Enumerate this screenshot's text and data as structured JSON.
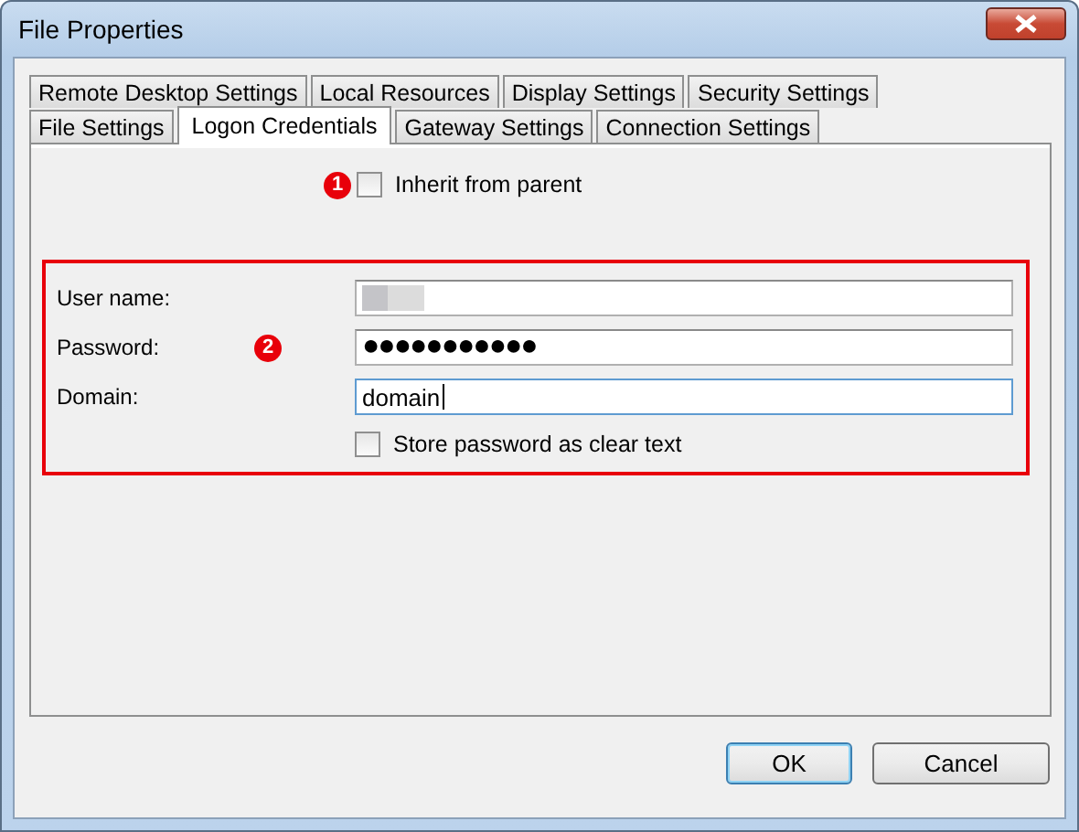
{
  "window": {
    "title": "File Properties"
  },
  "tab_rows": [
    [
      {
        "label": "Remote Desktop Settings",
        "selected": false
      },
      {
        "label": "Local Resources",
        "selected": false
      },
      {
        "label": "Display Settings",
        "selected": false
      },
      {
        "label": "Security Settings",
        "selected": false
      }
    ],
    [
      {
        "label": "File Settings",
        "selected": false
      },
      {
        "label": "Logon Credentials",
        "selected": true
      },
      {
        "label": "Gateway Settings",
        "selected": false
      },
      {
        "label": "Connection Settings",
        "selected": false
      }
    ]
  ],
  "inherit": {
    "callout": "1",
    "label": "Inherit from parent",
    "checked": false
  },
  "credentials": {
    "callout": "2",
    "fields": [
      {
        "label": "User name:",
        "kind": "redacted",
        "focused": false
      },
      {
        "label": "Password:",
        "kind": "password",
        "value": "●●●●●●●●●●●",
        "focused": false
      },
      {
        "label": "Domain:",
        "kind": "text",
        "value": "domain",
        "focused": true
      }
    ],
    "store_clear": {
      "label": "Store password as clear text",
      "checked": false
    }
  },
  "buttons": [
    {
      "label": "OK",
      "default": true
    },
    {
      "label": "Cancel",
      "default": false
    }
  ]
}
